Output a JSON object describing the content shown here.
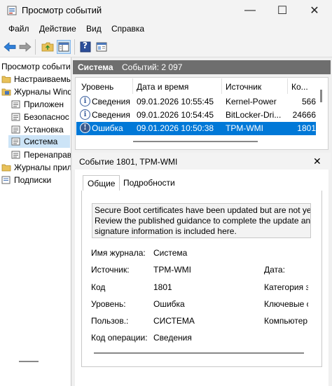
{
  "window": {
    "title": "Просмотр событий",
    "minimize_glyph": "—",
    "maximize_glyph": "☐",
    "close_glyph": "✕"
  },
  "menu": {
    "items": [
      "Файл",
      "Действие",
      "Вид",
      "Справка"
    ]
  },
  "toolbar": {
    "icons": [
      "back-arrow-icon",
      "forward-arrow-icon",
      "folder-up-icon",
      "show-hide-tree-icon",
      "help-icon",
      "properties-icon"
    ],
    "help_glyph": "?"
  },
  "tree": {
    "items": [
      {
        "label": "Просмотр событи",
        "icon": "event-viewer-icon"
      },
      {
        "label": "Настраиваемы",
        "icon": "folder-icon"
      },
      {
        "label": "Журналы Wind",
        "icon": "folder-icon"
      },
      {
        "label": "Приложен",
        "icon": "log-icon"
      },
      {
        "label": "Безопаснос",
        "icon": "log-icon"
      },
      {
        "label": "Установка",
        "icon": "log-icon"
      },
      {
        "label": "Система",
        "icon": "log-icon"
      },
      {
        "label": "Перенаправ",
        "icon": "log-icon"
      },
      {
        "label": "Журналы прил",
        "icon": "folder-icon"
      },
      {
        "label": "Подписки",
        "icon": "subscriptions-icon"
      }
    ],
    "selected": "Система"
  },
  "log": {
    "name": "Система",
    "count_text": "Событий: 2 097"
  },
  "events": {
    "columns": [
      "Уровень",
      "Дата и время",
      "Источник",
      "Код"
    ],
    "rows": [
      {
        "level": "Сведения",
        "datetime": "09.01.2026 10:55:45",
        "source": "Kernel-Power",
        "code": "566",
        "icon": "info-icon"
      },
      {
        "level": "Сведения",
        "datetime": "09.01.2026 10:54:45",
        "source": "BitLocker-Dri...",
        "code": "24666",
        "icon": "info-icon"
      },
      {
        "level": "Ошибка",
        "datetime": "09.01.2026 10:50:38",
        "source": "TPM-WMI",
        "code": "1801",
        "icon": "error-icon"
      }
    ],
    "selected_index": 2,
    "code_header_truncated": "Ко..."
  },
  "detail": {
    "title": "Событие 1801, TPM-WMI",
    "close_glyph": "✕",
    "tabs": [
      "Общие",
      "Подробности"
    ],
    "active_tab": "Общие",
    "description_lines": [
      "Secure Boot certificates have been updated but are not yet",
      "Review the published guidance to complete the update an",
      "signature information is included here."
    ],
    "fields_left": [
      {
        "label": "Имя журнала:",
        "value": "Система"
      },
      {
        "label": "Источник:",
        "value": "TPM-WMI"
      },
      {
        "label": "Код",
        "value": "1801"
      },
      {
        "label": "Уровень:",
        "value": "Ошибка"
      },
      {
        "label": "Пользов.:",
        "value": "СИСТЕМА"
      },
      {
        "label": "Код операции:",
        "value": "Сведения"
      }
    ],
    "fields_right": [
      "Дата:",
      "Категория з",
      "Ключевые с",
      "Компьютер"
    ]
  },
  "colors": {
    "selection": "#0078d7",
    "header_band": "#6e6e6e",
    "tree_selected": "#cce4f7"
  }
}
